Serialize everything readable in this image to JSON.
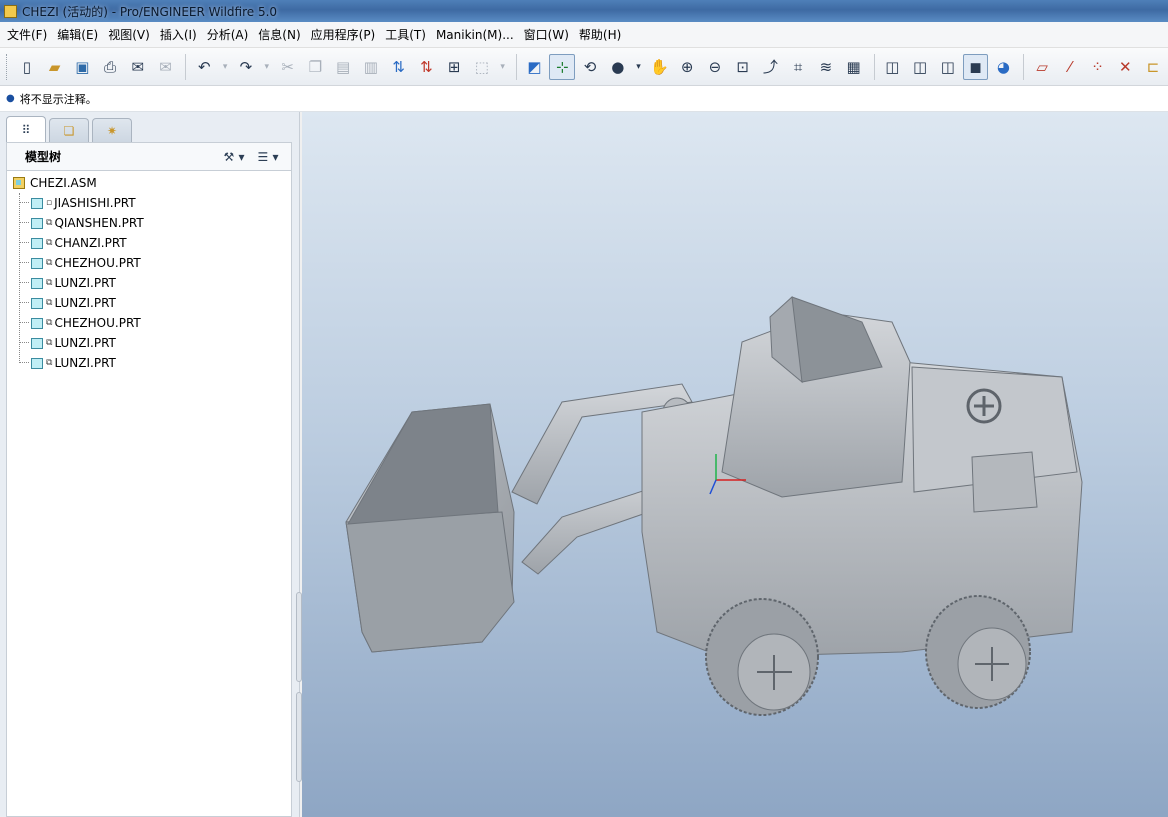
{
  "window": {
    "title": "CHEZI (活动的) - Pro/ENGINEER Wildfire 5.0"
  },
  "menu": [
    {
      "label": "文件(F)",
      "name": "menu-file"
    },
    {
      "label": "编辑(E)",
      "name": "menu-edit"
    },
    {
      "label": "视图(V)",
      "name": "menu-view"
    },
    {
      "label": "插入(I)",
      "name": "menu-insert"
    },
    {
      "label": "分析(A)",
      "name": "menu-analysis"
    },
    {
      "label": "信息(N)",
      "name": "menu-info"
    },
    {
      "label": "应用程序(P)",
      "name": "menu-applications"
    },
    {
      "label": "工具(T)",
      "name": "menu-tools"
    },
    {
      "label": "Manikin(M)...",
      "name": "menu-manikin"
    },
    {
      "label": "窗口(W)",
      "name": "menu-window"
    },
    {
      "label": "帮助(H)",
      "name": "menu-help"
    }
  ],
  "message": "将不显示注释。",
  "model_tree": {
    "header": "模型树",
    "root": "CHEZI.ASM",
    "items": [
      "JIASHISHI.PRT",
      "QIANSHEN.PRT",
      "CHANZI.PRT",
      "CHEZHOU.PRT",
      "LUNZI.PRT",
      "LUNZI.PRT",
      "CHEZHOU.PRT",
      "LUNZI.PRT",
      "LUNZI.PRT"
    ]
  },
  "colors": {
    "viewport_top": "#dde7f1",
    "viewport_bottom": "#8ea6c4",
    "model_gray": "#b8bcc2"
  }
}
